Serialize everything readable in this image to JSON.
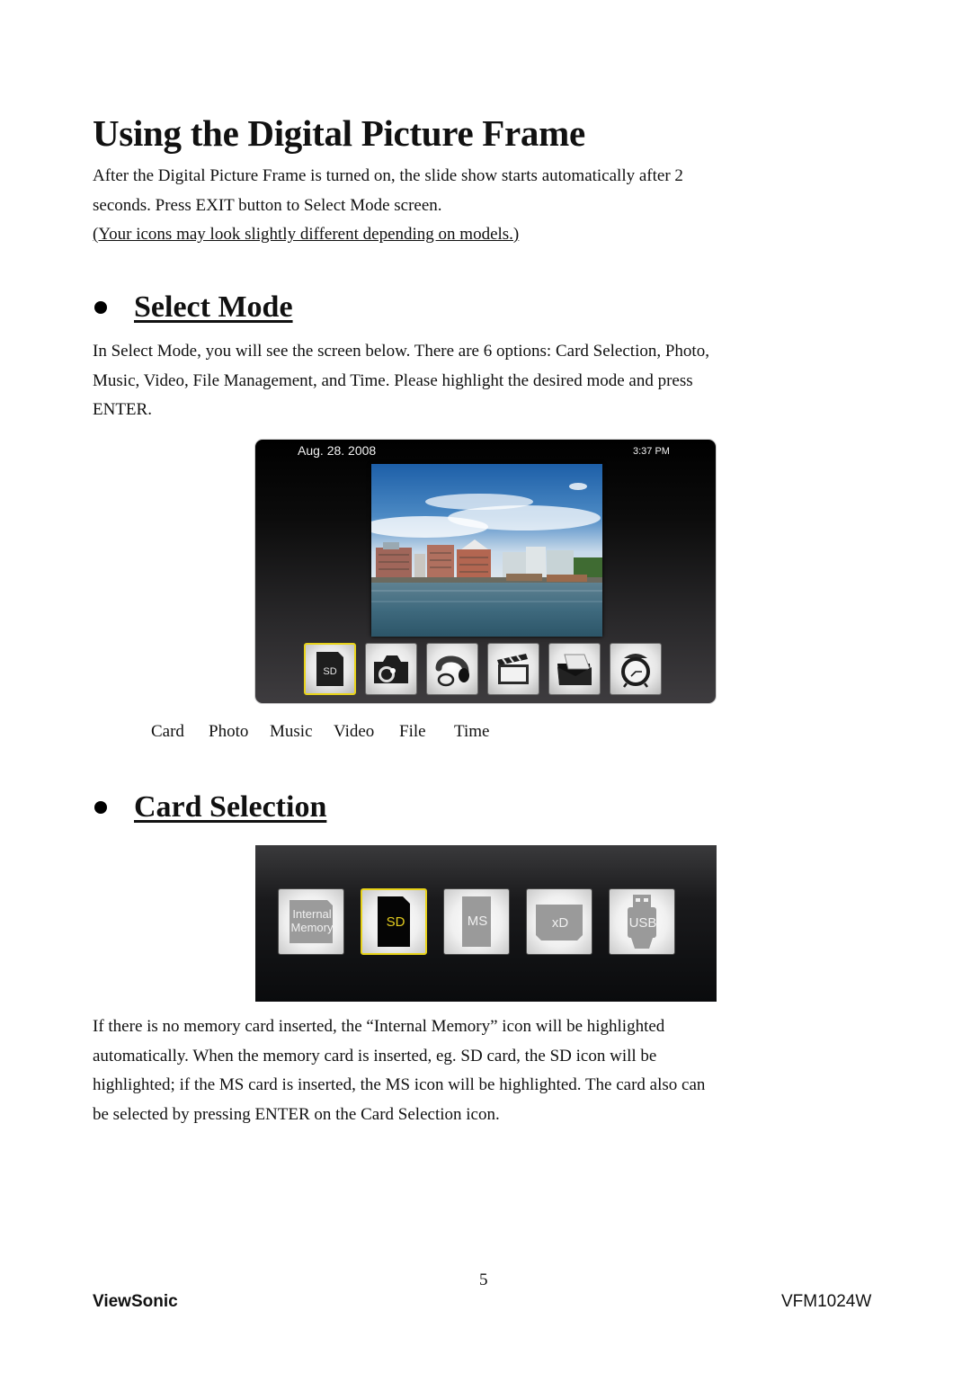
{
  "title": "Using the Digital Picture Frame",
  "intro": {
    "lines": [
      "After the Digital Picture Frame is turned on, the slide show starts automatically after 2",
      "seconds. Press EXIT button to Select Mode screen."
    ],
    "note": "(Your icons may look slightly different depending on models.)"
  },
  "select_mode": {
    "heading": "Select Mode",
    "lines": [
      "In Select Mode, you will see the screen below. There are 6 options: Card Selection, Photo,",
      "Music, Video, File Management, and Time. Please highlight the desired mode and press",
      "ENTER."
    ],
    "screen": {
      "date": "Aug. 28. 2008",
      "time": "3:37 PM",
      "photo": "waterfront-city-photo",
      "highlight_color": "#e8d31a",
      "modes": [
        {
          "icon": "sd-card-icon",
          "glyph": "SD",
          "selected": true
        },
        {
          "icon": "camera-icon",
          "selected": false
        },
        {
          "icon": "headphones-icon",
          "selected": false
        },
        {
          "icon": "clapperboard-icon",
          "selected": false
        },
        {
          "icon": "folder-icon",
          "selected": false
        },
        {
          "icon": "alarm-clock-icon",
          "selected": false
        }
      ]
    },
    "labels": [
      "Card",
      "Photo",
      "Music",
      "Video",
      "File",
      "Time"
    ]
  },
  "card_selection": {
    "heading": "Card Selection",
    "cards": [
      {
        "icon": "internal-memory-icon",
        "label_line1": "Internal",
        "label_line2": "Memory",
        "selected": false
      },
      {
        "icon": "sd-card-icon",
        "label_line1": "SD",
        "selected": true
      },
      {
        "icon": "ms-card-icon",
        "label_line1": "MS",
        "selected": false
      },
      {
        "icon": "xd-card-icon",
        "label_line1": "xD",
        "selected": false
      },
      {
        "icon": "usb-icon",
        "label_line1": "USB",
        "selected": false
      }
    ],
    "lines": [
      "If there is no memory card inserted, the “Internal Memory” icon will be highlighted",
      "automatically. When the memory card is inserted, eg. SD card, the SD icon will be",
      "highlighted; if the MS card is inserted, the MS icon will be highlighted. The card also can",
      "be selected by pressing ENTER on the Card Selection icon."
    ]
  },
  "footer": {
    "page_number": "5",
    "brand": "ViewSonic",
    "model": "VFM1024W"
  }
}
